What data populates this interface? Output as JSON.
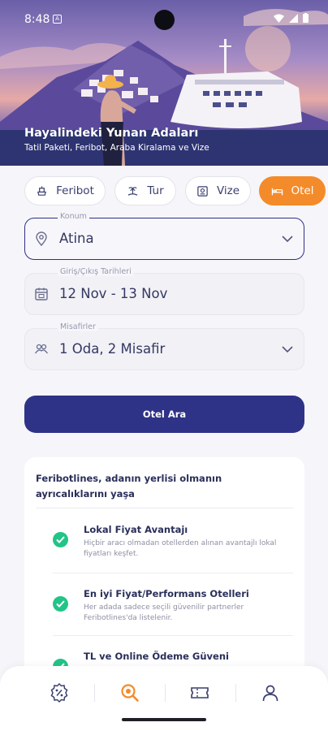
{
  "status": {
    "time": "8:48",
    "a_badge": "A"
  },
  "hero": {
    "title": "Hayalindeki Yunan Adaları",
    "subtitle": "Tatil Paketi, Feribot, Araba Kiralama ve Vize"
  },
  "tabs": [
    {
      "label": "Feribot",
      "icon": "ferry-icon",
      "active": false
    },
    {
      "label": "Tur",
      "icon": "tour-icon",
      "active": false
    },
    {
      "label": "Vize",
      "icon": "visa-icon",
      "active": false
    },
    {
      "label": "Otel",
      "icon": "hotel-icon",
      "active": true
    }
  ],
  "form": {
    "location": {
      "label": "Konum",
      "value": "Atina"
    },
    "dates": {
      "label": "Giriş/Çıkış Tarihleri",
      "value": "12 Nov - 13 Nov"
    },
    "guests": {
      "label": "Misafirler",
      "value": "1 Oda, 2 Misafir"
    },
    "search_label": "Otel Ara"
  },
  "advantages": {
    "title": "Feribotlines, adanın yerlisi olmanın ayrıcalıklarını yaşa",
    "items": [
      {
        "title": "Lokal Fiyat Avantajı",
        "desc": "Hiçbir aracı olmadan otellerden alınan avantajlı lokal fiyatları keşfet."
      },
      {
        "title": "En iyi Fiyat/Performans Otelleri",
        "desc": "Her adada sadece seçili güvenilir partnerler Feribotlines'da listelenir."
      },
      {
        "title": "TL ve Online Ödeme Güveni",
        "desc": ""
      }
    ]
  },
  "bottom_nav": [
    {
      "name": "deals-badge-icon",
      "active": false
    },
    {
      "name": "search-icon",
      "active": true
    },
    {
      "name": "ticket-icon",
      "active": false
    },
    {
      "name": "profile-icon",
      "active": false
    }
  ],
  "colors": {
    "accent": "#f48b2a",
    "primary": "#2f3387",
    "check": "#22c487"
  }
}
